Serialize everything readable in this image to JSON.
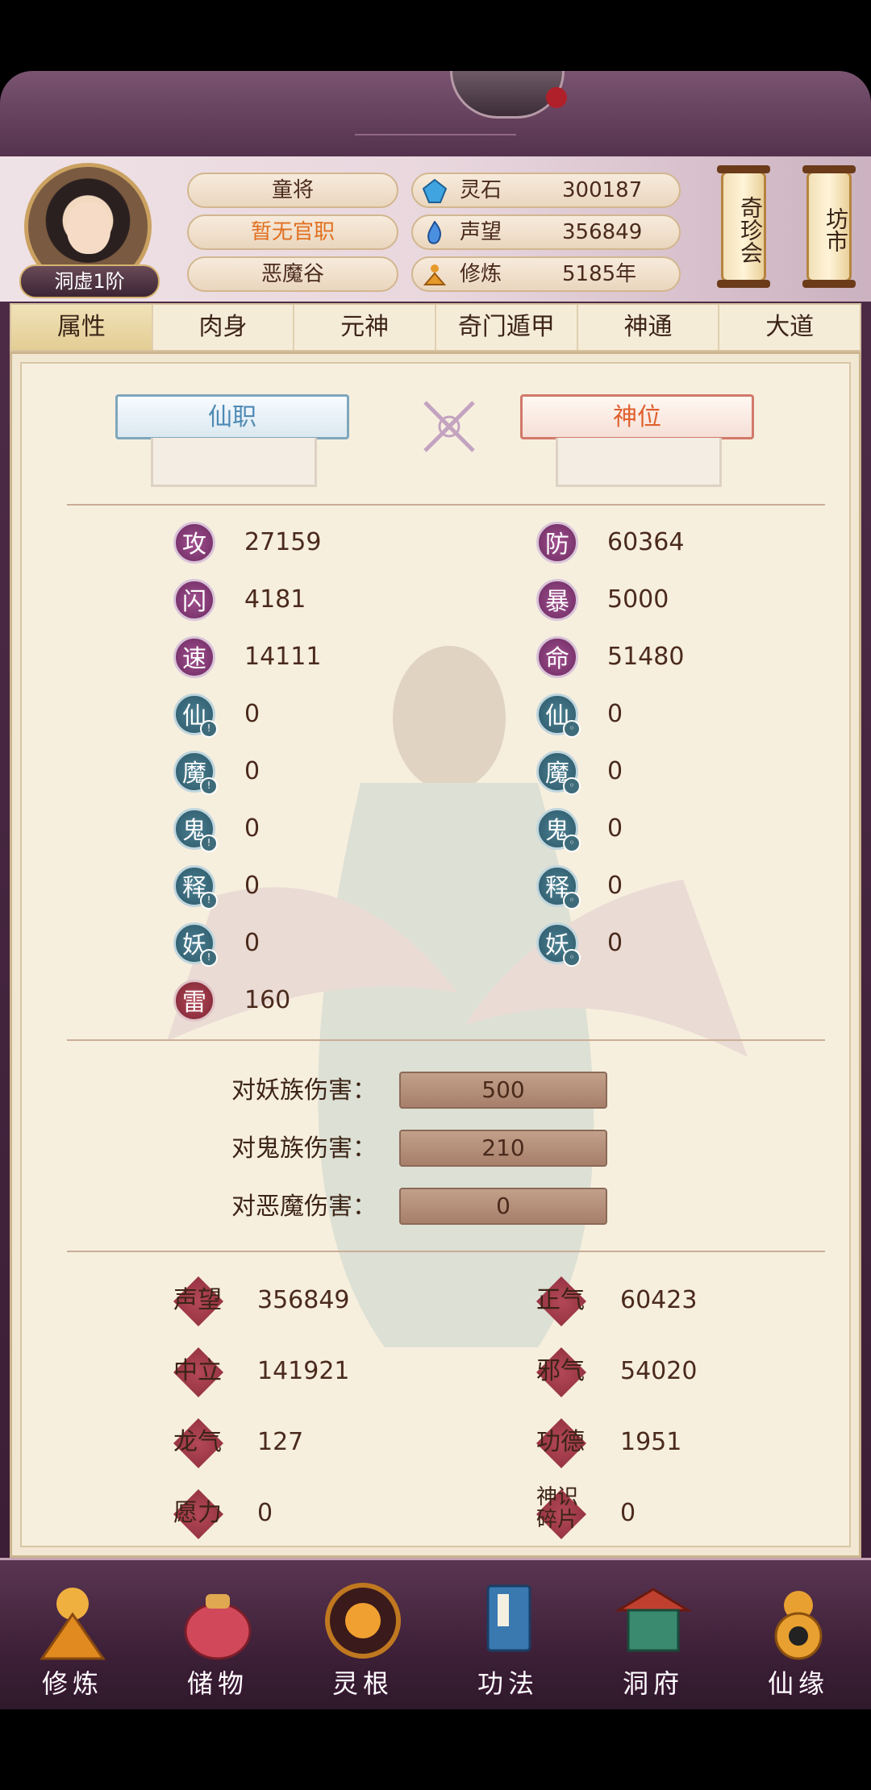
{
  "header": {
    "avatar_badge": "洞虚1阶",
    "title_pill": "童将",
    "office_pill": "暂无官职",
    "location_pill": "恶魔谷",
    "resources": [
      {
        "label": "灵石",
        "value": "300187"
      },
      {
        "label": "声望",
        "value": "356849"
      },
      {
        "label": "修炼",
        "value": "5185年"
      }
    ],
    "scroll_buttons": [
      "奇珍会",
      "坊市"
    ]
  },
  "tabs": [
    "属性",
    "肉身",
    "元神",
    "奇门遁甲",
    "神通",
    "大道"
  ],
  "active_tab": "属性",
  "banners": {
    "left": "仙职",
    "right": "神位"
  },
  "stats_left": [
    {
      "badge": "攻",
      "value": "27159"
    },
    {
      "badge": "闪",
      "value": "4181"
    },
    {
      "badge": "速",
      "value": "14111"
    },
    {
      "badge": "仙",
      "value": "0"
    },
    {
      "badge": "魔",
      "value": "0"
    },
    {
      "badge": "鬼",
      "value": "0"
    },
    {
      "badge": "释",
      "value": "0"
    },
    {
      "badge": "妖",
      "value": "0"
    },
    {
      "badge": "雷",
      "value": "160"
    }
  ],
  "stats_right": [
    {
      "badge": "防",
      "value": "60364"
    },
    {
      "badge": "暴",
      "value": "5000"
    },
    {
      "badge": "命",
      "value": "51480"
    },
    {
      "badge": "仙",
      "value": "0"
    },
    {
      "badge": "魔",
      "value": "0"
    },
    {
      "badge": "鬼",
      "value": "0"
    },
    {
      "badge": "释",
      "value": "0"
    },
    {
      "badge": "妖",
      "value": "0"
    }
  ],
  "damage": [
    {
      "label": "对妖族伤害：",
      "value": "500"
    },
    {
      "label": "对鬼族伤害：",
      "value": "210"
    },
    {
      "label": "对恶魔伤害：",
      "value": "0"
    }
  ],
  "reputation_left": [
    {
      "label": "声望",
      "value": "356849"
    },
    {
      "label": "中立",
      "value": "141921"
    },
    {
      "label": "龙气",
      "value": "127"
    },
    {
      "label": "愿力",
      "value": "0"
    }
  ],
  "reputation_right": [
    {
      "label": "正气",
      "value": "60423"
    },
    {
      "label": "邪气",
      "value": "54020"
    },
    {
      "label": "功德",
      "value": "1951"
    },
    {
      "label": "神识碎片",
      "value": "0"
    }
  ],
  "nav": [
    "修炼",
    "储物",
    "灵根",
    "功法",
    "洞府",
    "仙缘"
  ],
  "colors": {
    "accent_purple": "#6c2a60",
    "accent_teal": "#2b5868",
    "accent_red": "#8a2b3d",
    "office_orange": "#e07020"
  }
}
